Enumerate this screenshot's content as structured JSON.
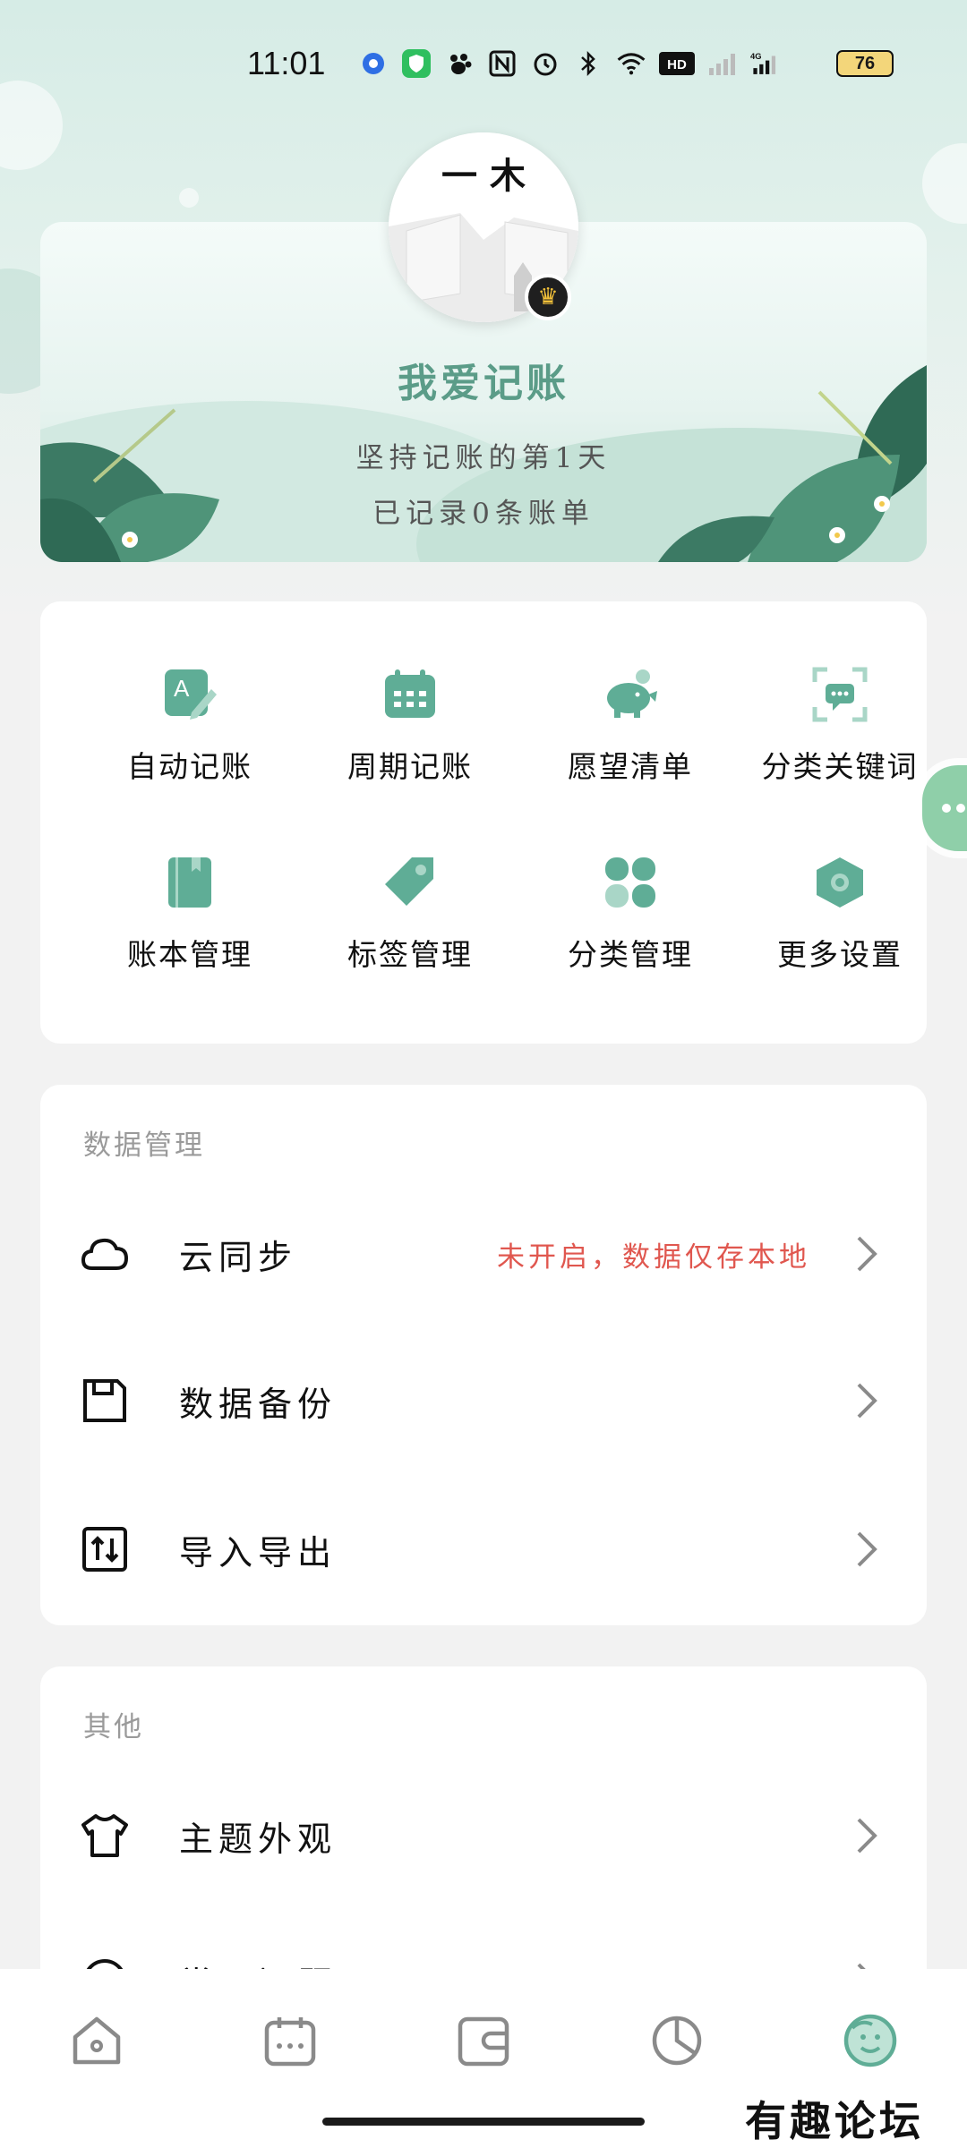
{
  "status_bar": {
    "time": "11:01",
    "battery": "76",
    "icons": [
      "location-dot-icon",
      "green-shield-icon",
      "paw-icon",
      "nfc-icon",
      "alarm-icon",
      "bluetooth-icon",
      "wifi-icon",
      "hd-icon",
      "signal-icon",
      "4g-signal-icon"
    ]
  },
  "profile": {
    "avatar_text": "一 木",
    "app_name": "我爱记账",
    "streak_text": "坚持记账的第1天",
    "record_text": "已记录0条账单"
  },
  "features": [
    {
      "label": "自动记账",
      "icon": "auto-bookkeeping-icon"
    },
    {
      "label": "周期记账",
      "icon": "calendar-icon"
    },
    {
      "label": "愿望清单",
      "icon": "piggy-bank-icon"
    },
    {
      "label": "分类关键词",
      "icon": "keyword-scan-icon"
    },
    {
      "label": "账本管理",
      "icon": "ledger-book-icon"
    },
    {
      "label": "标签管理",
      "icon": "tag-icon"
    },
    {
      "label": "分类管理",
      "icon": "category-grid-icon"
    },
    {
      "label": "更多设置",
      "icon": "settings-hex-icon"
    }
  ],
  "data_section": {
    "title": "数据管理",
    "rows": [
      {
        "label": "云同步",
        "value": "未开启，数据仅存本地",
        "icon": "cloud-icon"
      },
      {
        "label": "数据备份",
        "value": "",
        "icon": "save-disk-icon"
      },
      {
        "label": "导入导出",
        "value": "",
        "icon": "import-export-icon"
      }
    ]
  },
  "other_section": {
    "title": "其他",
    "rows": [
      {
        "label": "主题外观",
        "icon": "tshirt-icon"
      },
      {
        "label": "常见问题",
        "icon": "question-icon"
      }
    ]
  },
  "bottom_nav": [
    "home-icon",
    "calendar-nav-icon",
    "wallet-icon",
    "pie-chart-icon",
    "profile-face-icon"
  ],
  "watermark": "有趣论坛",
  "colors": {
    "accent": "#5fad96",
    "warning_text": "#e0574f",
    "float_button": "#8fcfa9"
  }
}
